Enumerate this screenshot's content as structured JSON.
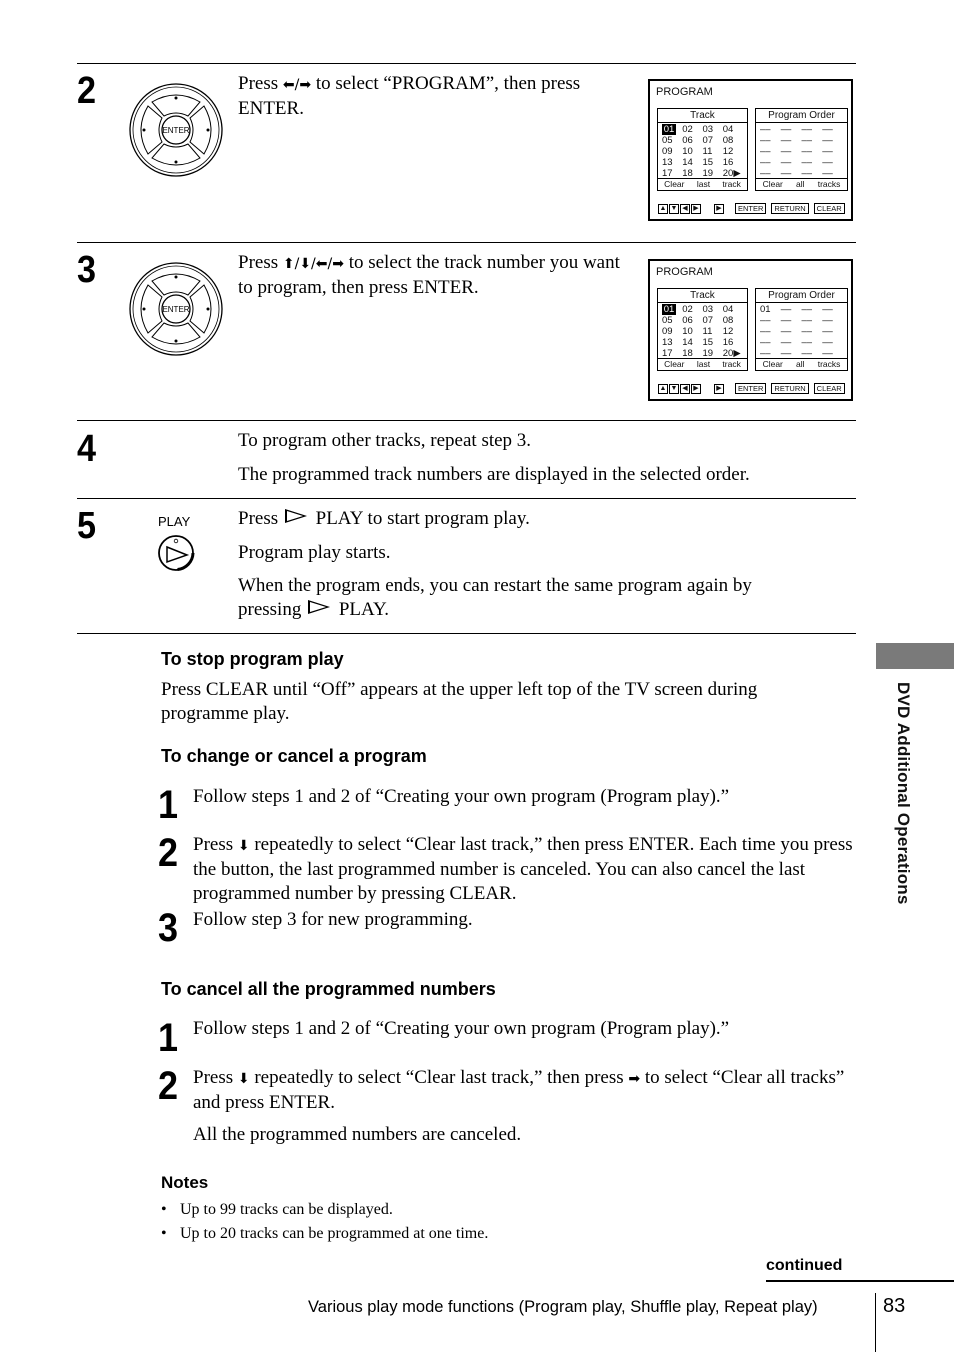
{
  "steps": [
    {
      "number": "2",
      "text_parts": [
        "Press ",
        "⬅/➡",
        " to select “PROGRAM”, then press ENTER."
      ],
      "image": "enter-dpad",
      "screen": {
        "title": "PROGRAM",
        "track_header": "Track",
        "tracks": [
          "01",
          "02",
          "03",
          "04",
          "05",
          "06",
          "07",
          "08",
          "09",
          "10",
          "11",
          "12",
          "13",
          "14",
          "15",
          "16",
          "17",
          "18",
          "19",
          "20▶"
        ],
        "selected_track": "01",
        "track_footer": [
          "Clear",
          "last",
          "track"
        ],
        "order_header": "Program Order",
        "order": [
          "––",
          "––",
          "––",
          "––",
          "––",
          "––",
          "––",
          "––",
          "––",
          "––",
          "––",
          "––",
          "––",
          "––",
          "––",
          "––",
          "––",
          "––",
          "––",
          "––"
        ],
        "order_footer": [
          "Clear",
          "all",
          "tracks"
        ],
        "buttons": [
          "ENTER",
          "RETURN",
          "CLEAR"
        ]
      }
    },
    {
      "number": "3",
      "text_parts": [
        "Press ",
        "⬆/⬇/⬅/➡",
        " to select the track number you want to program, then press ENTER."
      ],
      "image": "enter-dpad",
      "screen": {
        "title": "PROGRAM",
        "track_header": "Track",
        "tracks": [
          "01",
          "02",
          "03",
          "04",
          "05",
          "06",
          "07",
          "08",
          "09",
          "10",
          "11",
          "12",
          "13",
          "14",
          "15",
          "16",
          "17",
          "18",
          "19",
          "20▶"
        ],
        "selected_track": "01",
        "track_footer": [
          "Clear",
          "last",
          "track"
        ],
        "order_header": "Program Order",
        "order": [
          "01",
          "––",
          "––",
          "––",
          "––",
          "––",
          "––",
          "––",
          "––",
          "––",
          "––",
          "––",
          "––",
          "––",
          "––",
          "––",
          "––",
          "––",
          "––",
          "––"
        ],
        "order_footer": [
          "Clear",
          "all",
          "tracks"
        ],
        "buttons": [
          "ENTER",
          "RETURN",
          "CLEAR"
        ]
      }
    },
    {
      "number": "4",
      "paragraphs": [
        "To program other tracks, repeat step 3.",
        "The programmed track numbers are displayed in the selected order."
      ]
    },
    {
      "number": "5",
      "button_label": "PLAY",
      "p1": [
        "Press ",
        " PLAY to start program play."
      ],
      "p2": "Program play starts.",
      "p3": [
        "When the program ends, you can restart the same program again by pressing ",
        " PLAY."
      ]
    }
  ],
  "stop": {
    "heading": "To stop program play",
    "text": "Press CLEAR until “Off” appears at the upper left top of the TV screen during programme play."
  },
  "change": {
    "heading": "To change or cancel a program",
    "items": [
      {
        "num": "1",
        "text": "Follow steps 1 and 2 of “Creating your own program (Program play).”"
      },
      {
        "num": "2",
        "pre": "Press ",
        "arrow": "⬇",
        "post": " repeatedly to select “Clear last track,” then press ENTER.  Each time you press the button, the last programmed number is canceled.  You can also cancel the last programmed number by pressing CLEAR."
      },
      {
        "num": "3",
        "text": "Follow step 3 for new programming."
      }
    ]
  },
  "cancel_all": {
    "heading": "To cancel all the programmed numbers",
    "items": [
      {
        "num": "1",
        "text": "Follow steps 1 and 2 of “Creating your own program (Program play).”"
      },
      {
        "num": "2",
        "pre": "Press ",
        "arrow": "⬇",
        "mid": " repeatedly to select “Clear last track,” then press ",
        "arrow2": "➡",
        "post": " to select “Clear all tracks” and press ENTER."
      }
    ],
    "result": "All the programmed numbers are canceled."
  },
  "notes": {
    "heading": "Notes",
    "items": [
      "Up to 99 tracks can be displayed.",
      "Up to 20 tracks can be programmed at one time."
    ]
  },
  "side_label": "DVD Additional Operations",
  "footer": {
    "continued": "continued",
    "section_title": "Various play mode functions (Program play, Shuffle play, Repeat play)",
    "page_number": "83"
  }
}
